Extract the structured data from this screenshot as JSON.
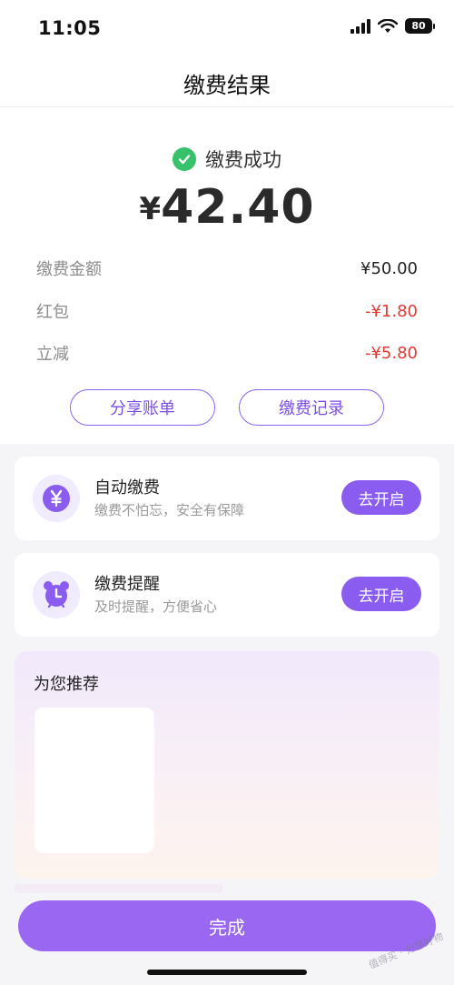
{
  "status_bar": {
    "time": "11:05",
    "battery": "80"
  },
  "nav": {
    "title": "缴费结果"
  },
  "result": {
    "status_text": "缴费成功",
    "currency": "¥",
    "amount": "42.40",
    "details": [
      {
        "label": "缴费金额",
        "value": "¥50.00"
      },
      {
        "label": "红包",
        "value": "-¥1.80"
      },
      {
        "label": "立减",
        "value": "-¥5.80"
      }
    ],
    "share_label": "分享账单",
    "records_label": "缴费记录"
  },
  "features": [
    {
      "title": "自动缴费",
      "subtitle": "缴费不怕忘，安全有保障",
      "button": "去开启",
      "icon": "yen-icon"
    },
    {
      "title": "缴费提醒",
      "subtitle": "及时提醒，方便省心",
      "button": "去开启",
      "icon": "alarm-clock-icon"
    }
  ],
  "recommend": {
    "title": "为您推荐"
  },
  "done_label": "完成",
  "watermark": "值得买 · 分享好物",
  "colors": {
    "accent": "#8a5cf0",
    "success": "#36c16a",
    "negative": "#e53935"
  }
}
